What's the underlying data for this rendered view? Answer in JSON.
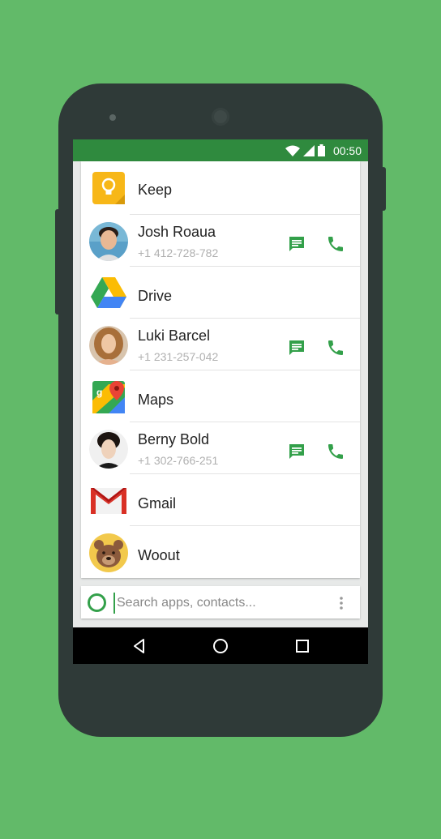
{
  "status_bar": {
    "time": "00:50",
    "bg_color": "#2f8a3e",
    "icons": [
      "wifi-icon",
      "signal-icon",
      "battery-icon"
    ]
  },
  "list": {
    "items": [
      {
        "type": "app",
        "name": "Keep",
        "icon": "keep-icon"
      },
      {
        "type": "contact",
        "name": "Josh Roaua",
        "phone": "+1 412-728-782",
        "icon": "avatar"
      },
      {
        "type": "app",
        "name": "Drive",
        "icon": "drive-icon"
      },
      {
        "type": "contact",
        "name": "Luki Barcel",
        "phone": "+1 231-257-042",
        "icon": "avatar"
      },
      {
        "type": "app",
        "name": "Maps",
        "icon": "maps-icon"
      },
      {
        "type": "contact",
        "name": "Berny Bold",
        "phone": "+1 302-766-251",
        "icon": "avatar"
      },
      {
        "type": "app",
        "name": "Gmail",
        "icon": "gmail-icon"
      },
      {
        "type": "app",
        "name": "Woout",
        "icon": "bear-icon"
      }
    ]
  },
  "search": {
    "placeholder": "Search apps, contacts..."
  },
  "nav_bar": {
    "icons": [
      "back-icon",
      "home-icon",
      "recents-icon"
    ]
  },
  "colors": {
    "background": "#62ba69",
    "accent": "#33a04a",
    "phone_body": "#2f3a38"
  }
}
